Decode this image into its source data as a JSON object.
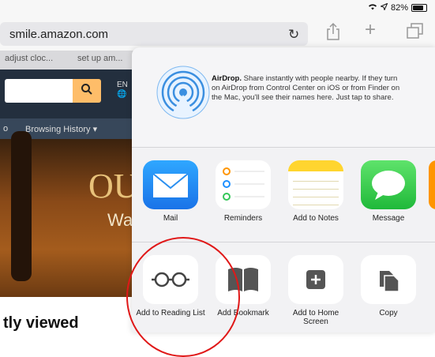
{
  "status": {
    "battery": "82%",
    "battery_level": 0.82
  },
  "browser": {
    "url": "smile.amazon.com",
    "tabs": [
      "adjust cloc...",
      "set up am..."
    ]
  },
  "page": {
    "lang": "EN",
    "nav_left": "o",
    "nav_item": "Browsing History ▾",
    "hero_title": "OU",
    "hero_sub": "Wa",
    "recent_title": "tly viewed"
  },
  "share_sheet": {
    "airdrop_title": "AirDrop.",
    "airdrop_text": " Share instantly with people nearby. If they turn on AirDrop from Control Center on iOS or from Finder on the Mac, you'll see their names here. Just tap to share.",
    "apps": [
      {
        "label": "Mail",
        "icon": "mail-icon"
      },
      {
        "label": "Reminders",
        "icon": "reminders-icon"
      },
      {
        "label": "Add to Notes",
        "icon": "notes-icon"
      },
      {
        "label": "Message",
        "icon": "message-icon"
      }
    ],
    "actions": [
      {
        "label": "Add to Reading List",
        "icon": "glasses-icon"
      },
      {
        "label": "Add Bookmark",
        "icon": "book-icon"
      },
      {
        "label": "Add to Home Screen",
        "icon": "plus-square-icon"
      },
      {
        "label": "Copy",
        "icon": "copy-icon"
      }
    ]
  },
  "colors": {
    "highlight_circle": "#e01818",
    "amazon_search_button": "#febd69"
  }
}
